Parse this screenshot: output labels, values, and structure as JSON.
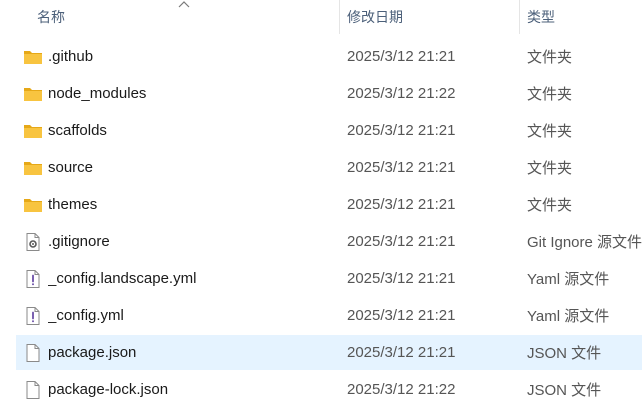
{
  "columns": {
    "name": "名称",
    "date": "修改日期",
    "type": "类型"
  },
  "sort": {
    "column": "name",
    "direction": "ascending"
  },
  "files": [
    {
      "name": ".github",
      "date": "2025/3/12 21:21",
      "type": "文件夹",
      "icon": "folder-icon"
    },
    {
      "name": "node_modules",
      "date": "2025/3/12 21:22",
      "type": "文件夹",
      "icon": "folder-icon"
    },
    {
      "name": "scaffolds",
      "date": "2025/3/12 21:21",
      "type": "文件夹",
      "icon": "folder-icon"
    },
    {
      "name": "source",
      "date": "2025/3/12 21:21",
      "type": "文件夹",
      "icon": "folder-icon"
    },
    {
      "name": "themes",
      "date": "2025/3/12 21:21",
      "type": "文件夹",
      "icon": "folder-icon"
    },
    {
      "name": ".gitignore",
      "date": "2025/3/12 21:21",
      "type": "Git Ignore 源文件",
      "icon": "settings-file-icon"
    },
    {
      "name": "_config.landscape.yml",
      "date": "2025/3/12 21:21",
      "type": "Yaml 源文件",
      "icon": "yaml-file-icon"
    },
    {
      "name": "_config.yml",
      "date": "2025/3/12 21:21",
      "type": "Yaml 源文件",
      "icon": "yaml-file-icon"
    },
    {
      "name": "package.json",
      "date": "2025/3/12 21:21",
      "type": "JSON 文件",
      "icon": "file-icon",
      "selected": true
    },
    {
      "name": "package-lock.json",
      "date": "2025/3/12 21:22",
      "type": "JSON 文件",
      "icon": "file-icon"
    }
  ],
  "colors": {
    "folder": "#f8c440",
    "folder_dark": "#e6a817",
    "selection": "#e5f3ff",
    "header_text": "#4c607a"
  }
}
